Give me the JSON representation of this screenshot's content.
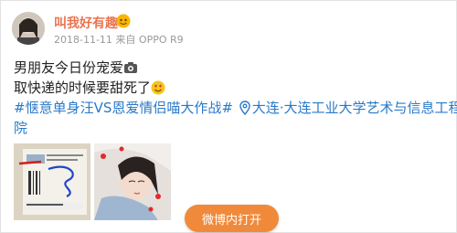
{
  "post": {
    "username": "叫我好有趣",
    "timestamp": "2018-11-11",
    "source": "来自 OPPO R9",
    "text_line1": "男朋友今日份宠爱",
    "text_line2": "取快递的时候要甜死了",
    "hashtag": "#惬意单身汪VS恩爱情侣喵大作战#",
    "location_part1": "大连·大连工业大学艺术与信息工程学",
    "location_part2": "院",
    "open_button": "微博内打开"
  },
  "colors": {
    "username": "#eb7350",
    "link": "#2a79c9",
    "button": "#f08a3a"
  },
  "icons": [
    "vip-badge-icon",
    "camera-emoji-icon",
    "heart-eyes-emoji-icon",
    "location-pin-icon"
  ]
}
